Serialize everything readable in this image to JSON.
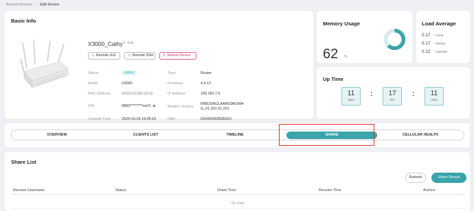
{
  "breadcrumb": {
    "parent": "Bound Devices",
    "separator": "/",
    "current": "Edit Device"
  },
  "basic_info": {
    "title": "Basic Info",
    "device_name": "X3000_Cathy",
    "edit_label": "Edit",
    "buttons": {
      "remote_gui": "Remote GUI",
      "remote_ssh": "Remote SSH",
      "reboot": "Reboot Device"
    },
    "fields": {
      "status_label": "Status",
      "status_value": "Online",
      "type_label": "Type",
      "type_value": "Router",
      "model_label": "Model",
      "model_value": "X3000",
      "firmware_label": "Firmware",
      "firmware_value": "4.4.13",
      "mac_label": "MAC Address",
      "mac_value": "94:83:C4:A8:1A:52",
      "ip_label": "IP Address",
      "ip_value": "166.182.7.5",
      "sn_label": "S/N",
      "sn_value": "9883*********ee21",
      "modem_label": "Modem Version",
      "modem_value_1": "RM520NGLAAR03A03M4",
      "modem_value_2": "G_01.201.01.201",
      "compile_label": "Compile Time",
      "compile_value": "2024-10-24 19:45:19",
      "imei_label": "IMEI",
      "imei_value": "016442002836910"
    }
  },
  "memory": {
    "title": "Memory Usage",
    "value": "62",
    "unit": "%",
    "percent": 62,
    "accent": "#3aa4aa"
  },
  "load_average": {
    "title": "Load Average",
    "rows": [
      {
        "value": "0.17",
        "unit": "/ 1min"
      },
      {
        "value": "0.17",
        "unit": "/ 5mins"
      },
      {
        "value": "0.12",
        "unit": "/ 15mins"
      }
    ]
  },
  "uptime": {
    "title": "Up Time",
    "days": "11",
    "days_label": "days",
    "hrs": "17",
    "hrs_label": "hrs",
    "mins": "11",
    "mins_label": "mins",
    "separator": ":"
  },
  "tabs": [
    {
      "label": "OVERVIEW",
      "active": false
    },
    {
      "label": "CLIENTS LIST",
      "active": false
    },
    {
      "label": "TIMELINE",
      "active": false
    },
    {
      "label": "SHARE",
      "active": true
    },
    {
      "label": "CELLULAR HEALTH",
      "active": false
    }
  ],
  "share_list": {
    "title": "Share List",
    "refresh_label": "Refresh",
    "share_device_label": "Share Device",
    "columns": [
      "Receive Username",
      "Status",
      "Share Time",
      "Receive Time",
      "Actions"
    ],
    "empty_text": "No Data"
  },
  "colors": {
    "accent": "#3aa4aa",
    "highlight": "#e03030",
    "reboot": "#d6336c"
  }
}
